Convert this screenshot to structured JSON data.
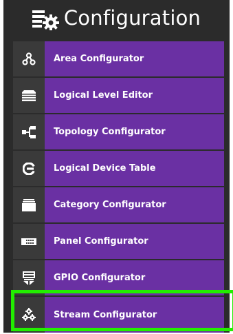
{
  "header": {
    "title": "Configuration",
    "icon": "configuration-gears-icon"
  },
  "menu": {
    "items": [
      {
        "label": "Area Configurator",
        "icon": "area-network-icon"
      },
      {
        "label": "Logical Level Editor",
        "icon": "layers-icon"
      },
      {
        "label": "Topology Configurator",
        "icon": "topology-icon"
      },
      {
        "label": "Logical Device Table",
        "icon": "logical-device-icon"
      },
      {
        "label": "Category Configurator",
        "icon": "category-icon"
      },
      {
        "label": "Panel Configurator",
        "icon": "panel-icon"
      },
      {
        "label": "GPIO Configurator",
        "icon": "gpio-icon"
      },
      {
        "label": "Stream Configurator",
        "icon": "stream-gears-icon",
        "selected": true
      }
    ]
  },
  "colors": {
    "background": "#2b2b2b",
    "icon_cell": "#3a3a3a",
    "item": "#6a30a3",
    "highlight": "#22ee00",
    "text": "#ffffff"
  }
}
